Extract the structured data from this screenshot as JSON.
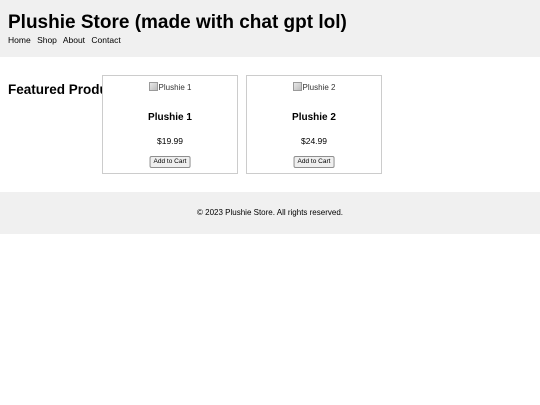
{
  "header": {
    "title": "Plushie Store (made with chat gpt lol)",
    "nav": [
      "Home",
      "Shop",
      "About",
      "Contact"
    ]
  },
  "main": {
    "section_heading": "Featured Products",
    "products": [
      {
        "image_alt": "Plushie 1",
        "name": "Plushie 1",
        "price": "$19.99",
        "button_label": "Add to Cart"
      },
      {
        "image_alt": "Plushie 2",
        "name": "Plushie 2",
        "price": "$24.99",
        "button_label": "Add to Cart"
      }
    ]
  },
  "footer": {
    "text": "© 2023 Plushie Store. All rights reserved."
  },
  "colors": {
    "header_background": "#f0f0f0",
    "footer_background": "#f0f0f0",
    "card_border": "#cccccc"
  }
}
